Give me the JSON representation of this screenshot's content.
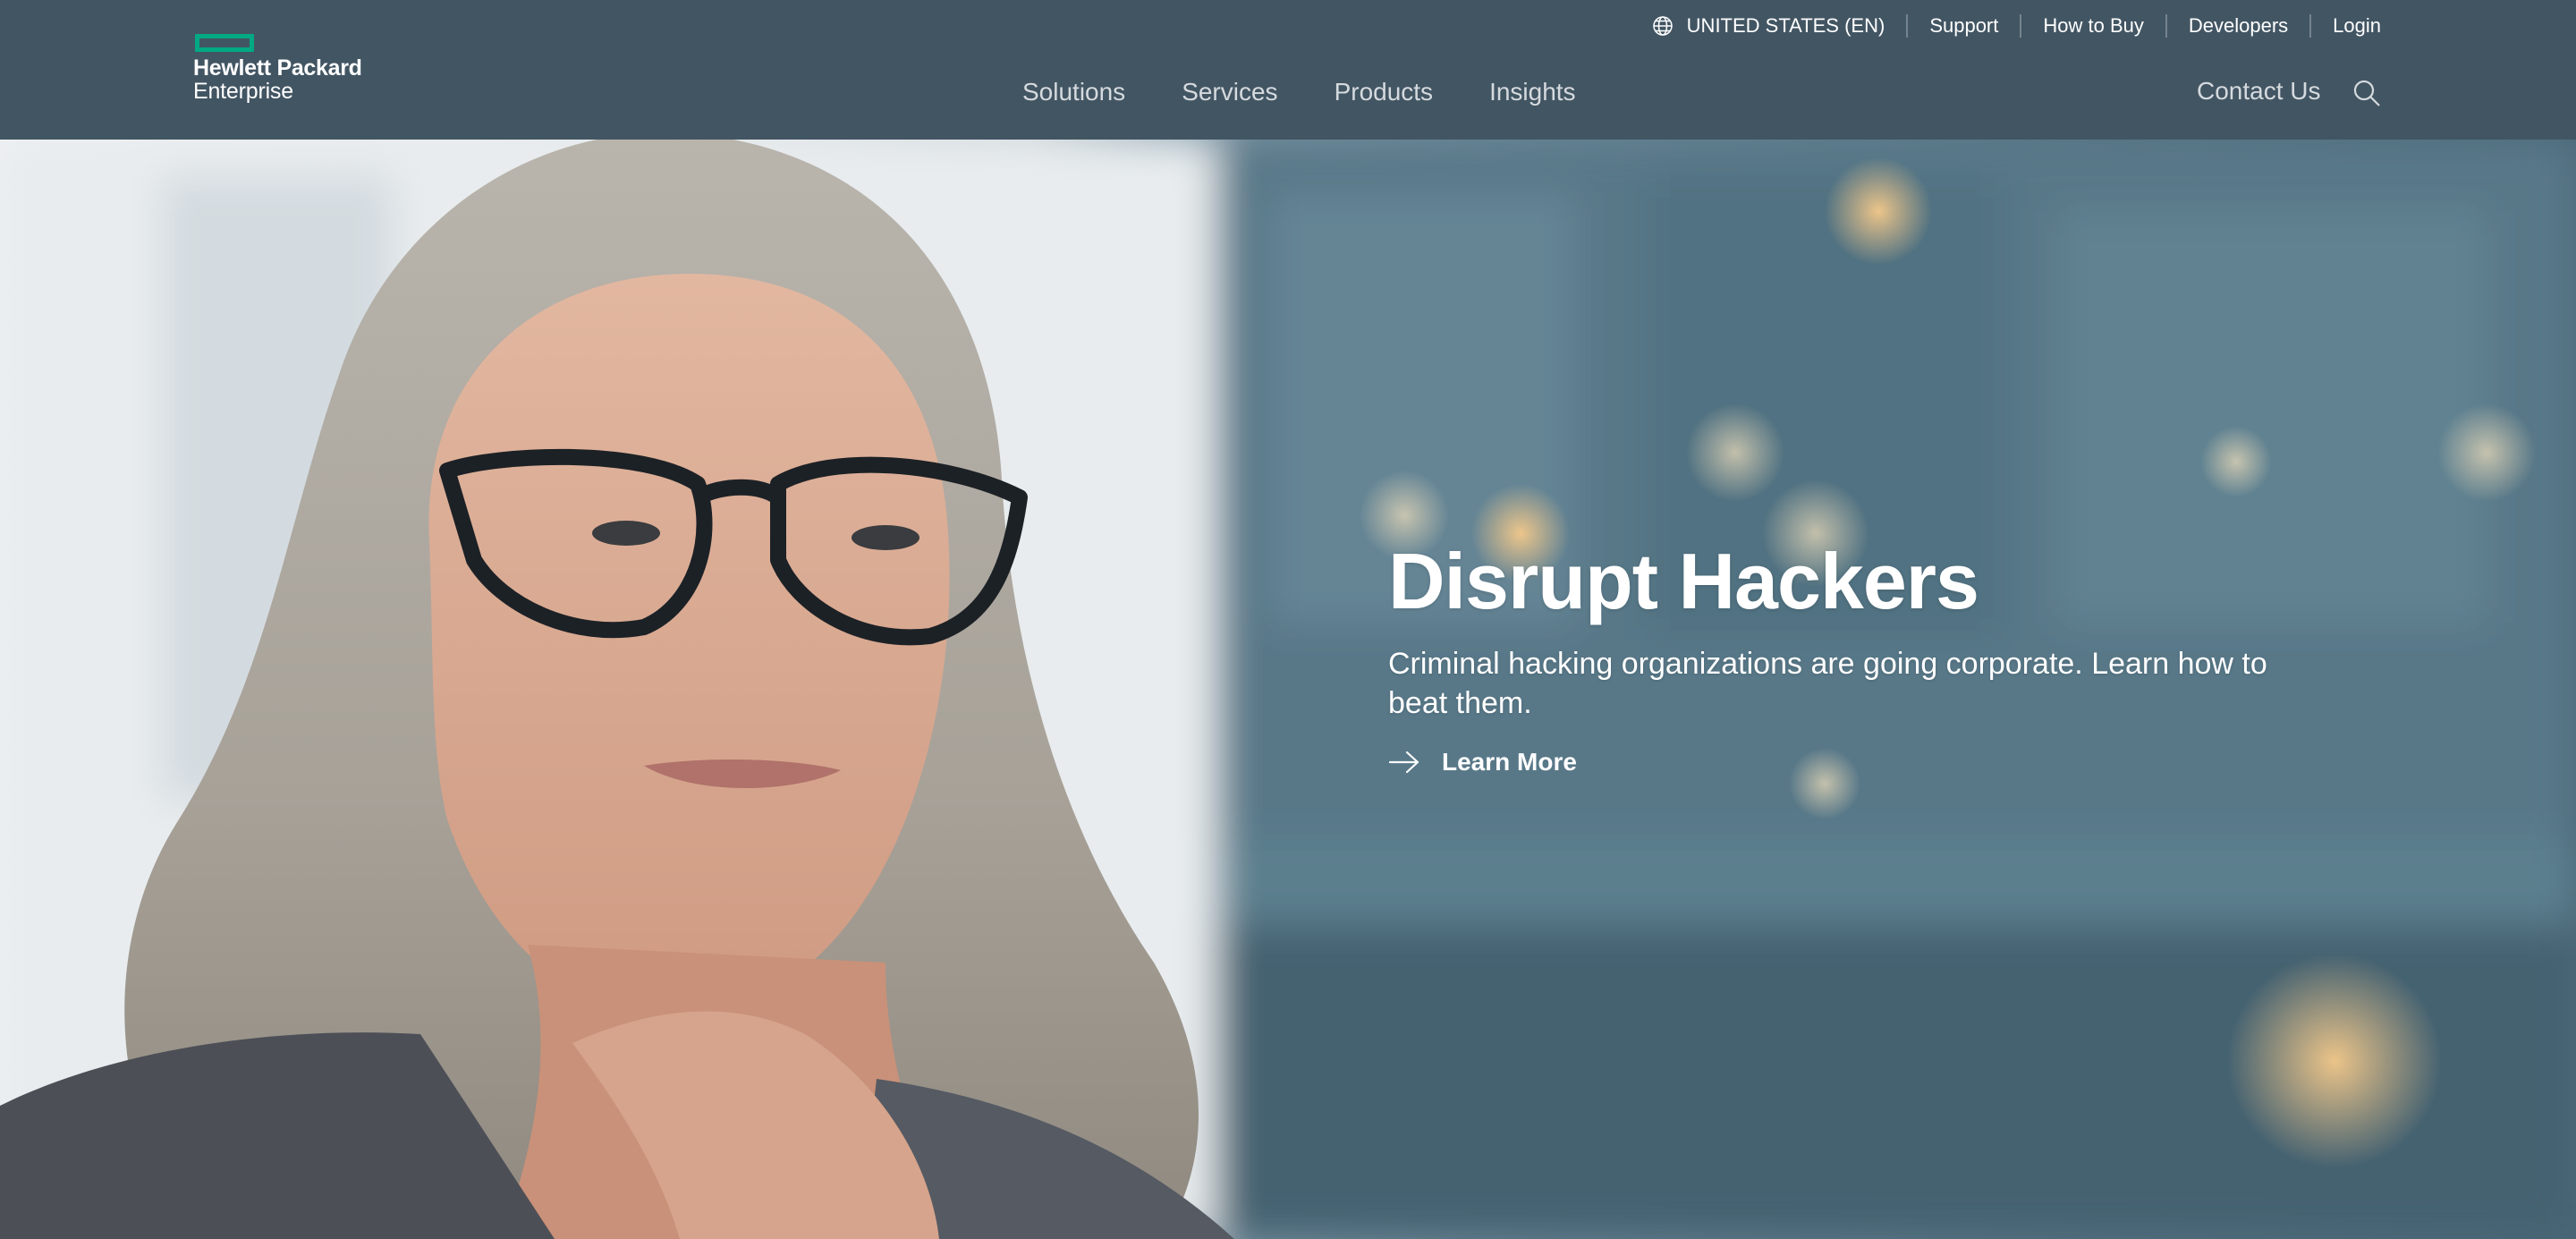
{
  "brand": {
    "line1": "Hewlett Packard",
    "line2": "Enterprise",
    "accent_color": "#01a982",
    "header_color": "#425563"
  },
  "utility_nav": {
    "region": "UNITED STATES (EN)",
    "region_icon": "globe-icon",
    "items": [
      "Support",
      "How to Buy",
      "Developers",
      "Login"
    ]
  },
  "main_nav": {
    "items": [
      "Solutions",
      "Services",
      "Products",
      "Insights"
    ],
    "contact": "Contact Us",
    "search_icon": "search-icon"
  },
  "hero": {
    "title": "Disrupt Hackers",
    "subtitle": "Criminal hacking organizations are going corporate. Learn how to beat them.",
    "cta_label": "Learn More",
    "cta_icon": "arrow-right-icon"
  }
}
